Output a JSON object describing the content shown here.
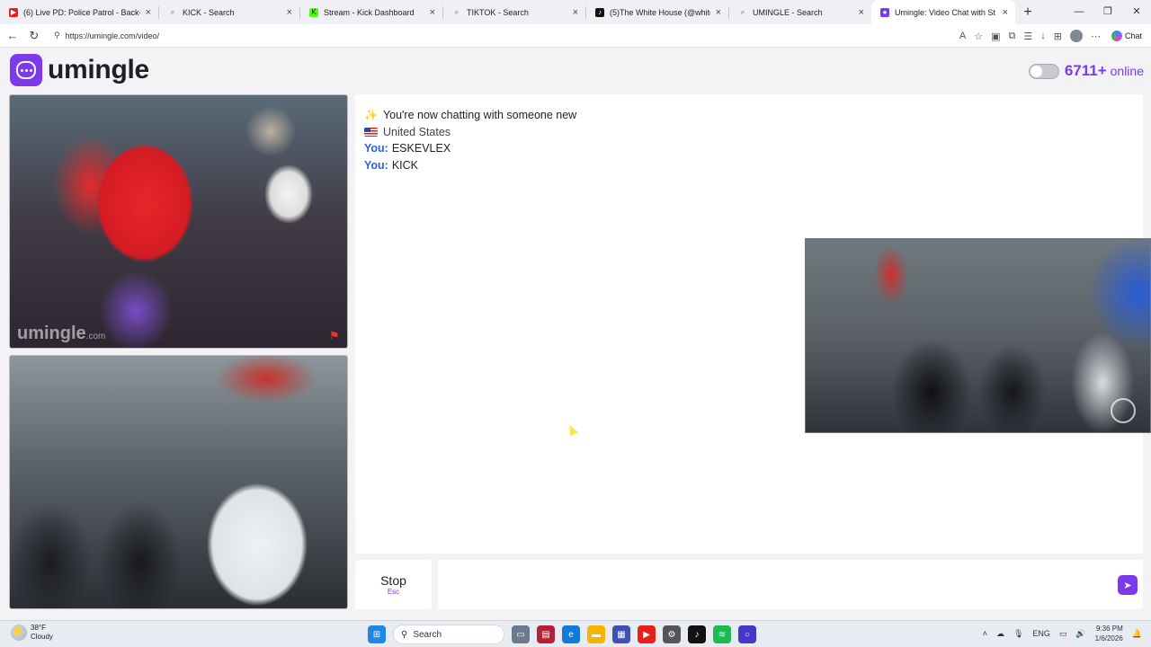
{
  "browser": {
    "tabs": [
      {
        "label": "(6) Live PD: Police Patrol - Back-to",
        "icon": "youtube-icon",
        "color": "#e62117",
        "active": false
      },
      {
        "label": "KICK - Search",
        "icon": "search-icon",
        "color": "#5f6368",
        "active": false
      },
      {
        "label": "Stream - Kick Dashboard",
        "icon": "kick-icon",
        "color": "#53fc18",
        "active": false
      },
      {
        "label": "TIKTOK - Search",
        "icon": "search-icon",
        "color": "#5f6368",
        "active": false
      },
      {
        "label": "(5)The White House (@whitehous",
        "icon": "tiktok-icon",
        "color": "#111111",
        "active": false
      },
      {
        "label": "UMINGLE - Search",
        "icon": "search-icon",
        "color": "#5f6368",
        "active": false
      },
      {
        "label": "Umingle: Video Chat with St",
        "icon": "umingle-icon",
        "color": "#7c3aed",
        "active": true
      }
    ],
    "url": "https://umingle.com/video/",
    "chat_button": "Chat"
  },
  "header": {
    "logo_text": "umingle",
    "online_count": "6711+",
    "online_label": "online"
  },
  "video": {
    "watermark_main": "umingle",
    "watermark_suffix": ".com"
  },
  "chat": {
    "intro": "You're now chatting with someone new",
    "country": "United States",
    "messages": [
      {
        "sender": "You:",
        "text": "ESKEVLEX"
      },
      {
        "sender": "You:",
        "text": "KICK"
      }
    ]
  },
  "controls": {
    "stop_label": "Stop",
    "stop_shortcut": "Esc"
  },
  "taskbar": {
    "weather_temp": "38°F",
    "weather_desc": "Cloudy",
    "search_label": "Search",
    "language": "ENG",
    "time": "9:36 PM",
    "date": "1/6/2026"
  },
  "colors": {
    "accent": "#7c3aed",
    "you_label": "#2563eb"
  }
}
